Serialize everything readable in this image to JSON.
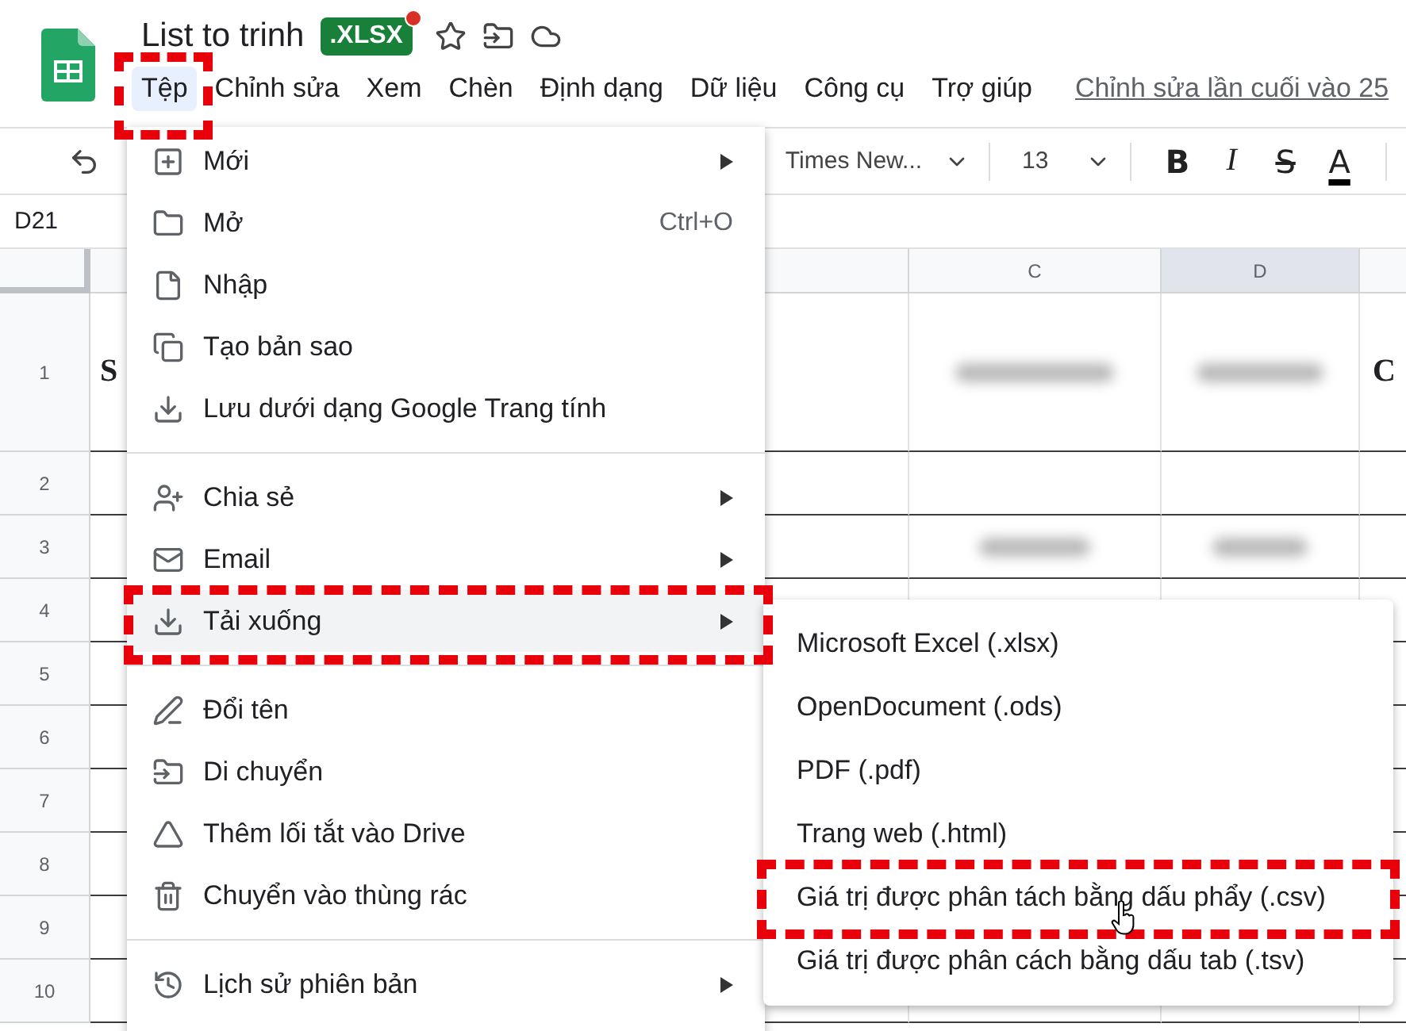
{
  "app": {
    "title": "List to trinh",
    "badge": ".XLSX",
    "badge_alert": true,
    "last_edit": "Chỉnh sửa lần cuối vào 25"
  },
  "menu_bar": [
    {
      "label": "Tệp",
      "selected": true,
      "annotated": true
    },
    {
      "label": "Chỉnh sửa",
      "selected": false
    },
    {
      "label": "Xem",
      "selected": false
    },
    {
      "label": "Chèn",
      "selected": false
    },
    {
      "label": "Định dạng",
      "selected": false
    },
    {
      "label": "Dữ liệu",
      "selected": false
    },
    {
      "label": "Công cụ",
      "selected": false
    },
    {
      "label": "Trợ giúp",
      "selected": false
    }
  ],
  "toolbar": {
    "font": "Times New...",
    "font_size": "13",
    "format_buttons": [
      "B",
      "I",
      "S",
      "A"
    ]
  },
  "name_box": "D21",
  "column_headers": [
    {
      "label": "C",
      "selected": false
    },
    {
      "label": "D",
      "selected": true
    }
  ],
  "row_headers": [
    "1",
    "2",
    "3",
    "4",
    "5",
    "6",
    "7",
    "8",
    "9",
    "10"
  ],
  "cell_a1": "S",
  "cell_e1": "C",
  "file_menu": [
    [
      {
        "label": "Mới",
        "submenu": true,
        "selected": false
      },
      {
        "label": "Mở",
        "shortcut": "Ctrl+O",
        "submenu": false,
        "selected": false
      },
      {
        "label": "Nhập",
        "submenu": false,
        "selected": false
      },
      {
        "label": "Tạo bản sao",
        "submenu": false,
        "selected": false
      },
      {
        "label": "Lưu dưới dạng Google Trang tính",
        "submenu": false,
        "selected": false
      }
    ],
    [
      {
        "label": "Chia sẻ",
        "submenu": true,
        "selected": false
      },
      {
        "label": "Email",
        "submenu": true,
        "selected": false
      },
      {
        "label": "Tải xuống",
        "submenu": true,
        "selected": true,
        "annotated": true
      }
    ],
    [
      {
        "label": "Đổi tên",
        "submenu": false,
        "selected": false
      },
      {
        "label": "Di chuyển",
        "submenu": false,
        "selected": false
      },
      {
        "label": "Thêm lối tắt vào Drive",
        "submenu": false,
        "selected": false
      },
      {
        "label": "Chuyển vào thùng rác",
        "submenu": false,
        "selected": false
      }
    ],
    [
      {
        "label": "Lịch sử phiên bản",
        "submenu": true,
        "selected": false
      }
    ]
  ],
  "download_submenu": [
    {
      "label": "Microsoft Excel (.xlsx)",
      "selected": false
    },
    {
      "label": "OpenDocument (.ods)",
      "selected": false
    },
    {
      "label": "PDF (.pdf)",
      "selected": false
    },
    {
      "label": "Trang web (.html)",
      "selected": false
    },
    {
      "label": "Giá trị được phân tách bằng dấu phẩy (.csv)",
      "selected": false,
      "annotated": true,
      "pointer": true
    },
    {
      "label": "Giá trị được phân cách bằng dấu tab (.tsv)",
      "selected": false
    }
  ]
}
